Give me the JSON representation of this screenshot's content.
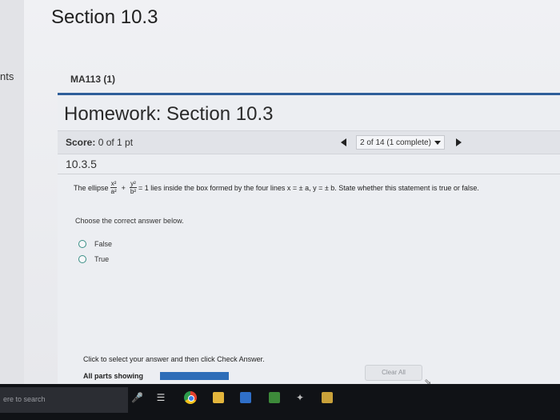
{
  "browser": {
    "section_heading": "Section 10.3",
    "left_tab_label": "nts"
  },
  "course": {
    "label": "MA113 (1)"
  },
  "homework": {
    "title": "Homework: Section 10.3",
    "score_label": "Score:",
    "score_value": "0 of 1 pt",
    "question_selector": "2 of 14 (1 complete)",
    "question_number": "10.3.5"
  },
  "question": {
    "prefix": "The ellipse",
    "frac1_num": "x²",
    "frac1_den": "a²",
    "frac2_num": "y²",
    "frac2_den": "b²",
    "plus": "+",
    "suffix": "= 1 lies inside the box formed by the four lines x = ± a, y = ± b. State whether this statement is true or false.",
    "instruction": "Choose the correct answer below.",
    "options": [
      {
        "label": "False"
      },
      {
        "label": "True"
      }
    ]
  },
  "footer": {
    "hint": "Click to select your answer and then click Check Answer.",
    "parts_showing": "All parts showing",
    "progress_fraction": 1.0,
    "clear_all": "Clear All"
  },
  "taskbar": {
    "search_text": "ere to search",
    "icons": [
      "mic-icon",
      "task-view-icon",
      "chrome-icon",
      "file-explorer-icon",
      "mail-icon",
      "office-icon",
      "app-icon",
      "folder-icon"
    ]
  },
  "colors": {
    "accent": "#2e5f9a",
    "progress": "#2e6db8",
    "radio": "#3a8f86",
    "taskbar": "#101216"
  }
}
